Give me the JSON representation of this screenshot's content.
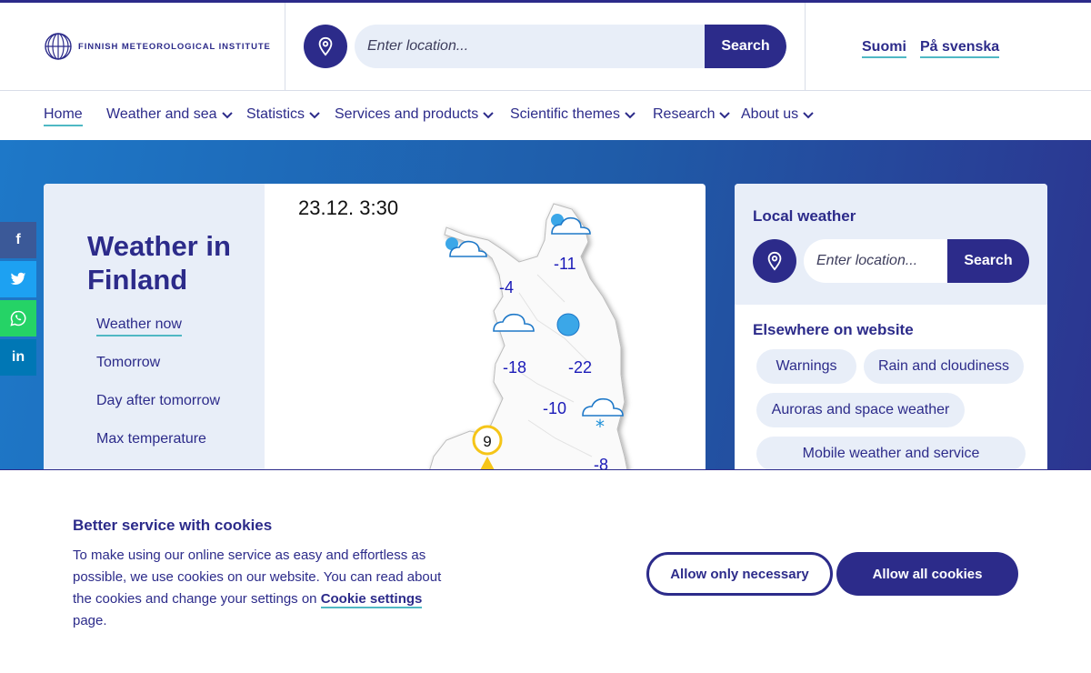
{
  "header": {
    "logo_text": "FINNISH METEOROLOGICAL INSTITUTE",
    "search": {
      "placeholder": "Enter location...",
      "button_label": "Search"
    },
    "languages": [
      "Suomi",
      "På svenska"
    ]
  },
  "nav": {
    "items": [
      {
        "label": "Home",
        "active": true,
        "has_dropdown": false
      },
      {
        "label": "Weather and sea",
        "has_dropdown": true
      },
      {
        "label": "Statistics",
        "has_dropdown": true
      },
      {
        "label": "Services and products",
        "has_dropdown": true
      },
      {
        "label": "Scientific themes",
        "has_dropdown": true
      },
      {
        "label": "Research",
        "has_dropdown": true
      },
      {
        "label": "About us",
        "has_dropdown": true
      }
    ]
  },
  "weather_card": {
    "title_line1": "Weather in",
    "title_line2": "Finland",
    "links": [
      {
        "label": "Weather now",
        "active": true
      },
      {
        "label": "Tomorrow"
      },
      {
        "label": "Day after tomorrow"
      },
      {
        "label": "Max temperature"
      }
    ],
    "map": {
      "timestamp": "23.12. 3:30",
      "temperatures": [
        "-11",
        "-4",
        "-18",
        "-22",
        "-10",
        "-8"
      ],
      "marker_value": "9",
      "icons": [
        "partly-cloudy-icon",
        "cloud-icon",
        "cloud-icon",
        "cloud-icon",
        "sun-icon",
        "snow-icon"
      ]
    }
  },
  "local_weather": {
    "title": "Local weather",
    "search": {
      "placeholder": "Enter location...",
      "button_label": "Search"
    },
    "elsewhere_title": "Elsewhere on website",
    "chips": [
      "Warnings",
      "Rain and cloudiness",
      "Auroras and space weather",
      "Mobile weather and service"
    ]
  },
  "social": [
    {
      "icon": "facebook-icon",
      "glyph": "f",
      "color": "#3b5998"
    },
    {
      "icon": "twitter-icon",
      "glyph": "t",
      "color": "#1da1f2"
    },
    {
      "icon": "whatsapp-icon",
      "glyph": "w",
      "color": "#25d366"
    },
    {
      "icon": "linkedin-icon",
      "glyph": "in",
      "color": "#0077b5"
    }
  ],
  "cookie_banner": {
    "title": "Better service with cookies",
    "text_before": "To make using our online service as easy and effortless as possible, we use cookies on our website. You can read about the cookies and change your settings on ",
    "link_text": "Cookie settings ",
    "text_after": "page.",
    "btn_necessary": "Allow only necessary",
    "btn_all": "Allow all cookies"
  },
  "colors": {
    "brand": "#2c2b8a",
    "accent": "#4fb8c4",
    "light_bg": "#e8eef8"
  }
}
